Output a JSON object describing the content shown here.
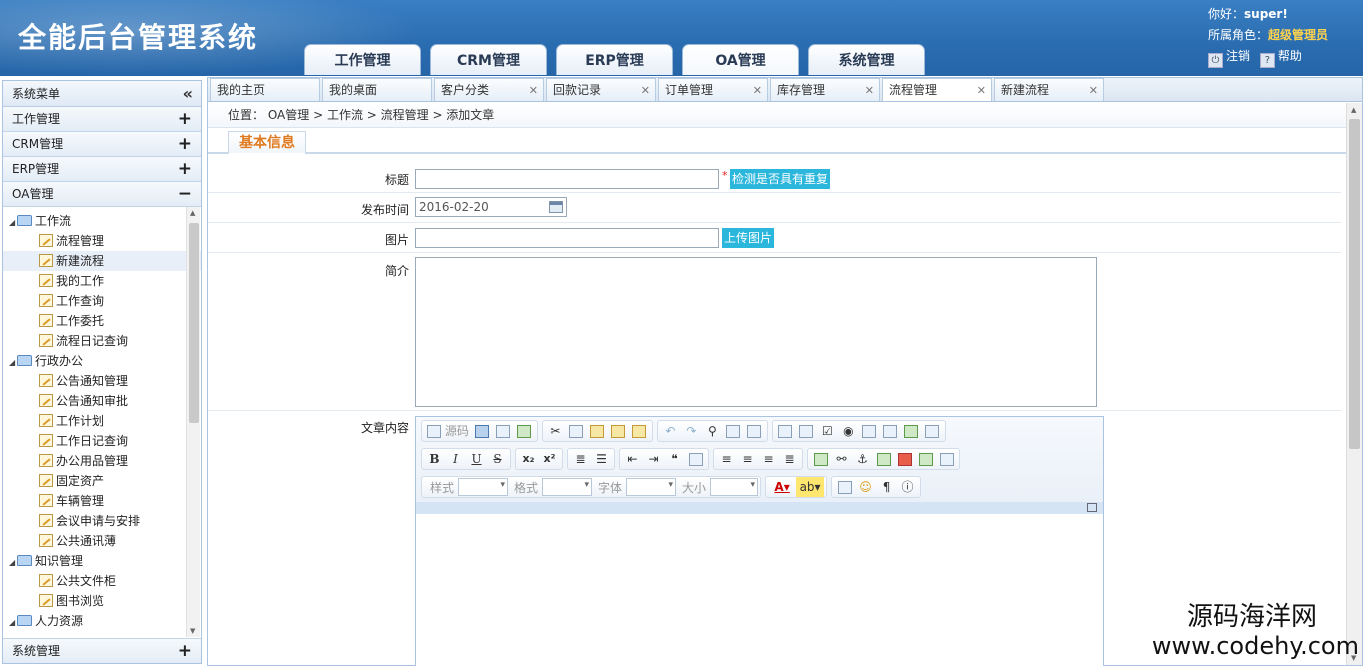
{
  "app": {
    "title": "全能后台管理系统",
    "main_tabs": [
      "工作管理",
      "CRM管理",
      "ERP管理",
      "OA管理",
      "系统管理"
    ]
  },
  "user": {
    "greeting": "你好：",
    "name": "super!",
    "role_label": "所属角色：",
    "role": "超级管理员",
    "logout": "注销",
    "help": "帮助"
  },
  "sidebar": {
    "title": "系统菜单",
    "collapse_icon": "«",
    "groups": [
      {
        "label": "工作管理",
        "toggle": "+"
      },
      {
        "label": "CRM管理",
        "toggle": "+"
      },
      {
        "label": "ERP管理",
        "toggle": "+"
      },
      {
        "label": "OA管理",
        "toggle": "−"
      }
    ],
    "tree": [
      {
        "label": "工作流",
        "type": "folder"
      },
      {
        "label": "流程管理",
        "type": "leaf"
      },
      {
        "label": "新建流程",
        "type": "leaf",
        "selected": true
      },
      {
        "label": "我的工作",
        "type": "leaf"
      },
      {
        "label": "工作查询",
        "type": "leaf"
      },
      {
        "label": "工作委托",
        "type": "leaf"
      },
      {
        "label": "流程日记查询",
        "type": "leaf"
      },
      {
        "label": "行政办公",
        "type": "folder"
      },
      {
        "label": "公告通知管理",
        "type": "leaf"
      },
      {
        "label": "公告通知审批",
        "type": "leaf"
      },
      {
        "label": "工作计划",
        "type": "leaf"
      },
      {
        "label": "工作日记查询",
        "type": "leaf"
      },
      {
        "label": "办公用品管理",
        "type": "leaf"
      },
      {
        "label": "固定资产",
        "type": "leaf"
      },
      {
        "label": "车辆管理",
        "type": "leaf"
      },
      {
        "label": "会议申请与安排",
        "type": "leaf"
      },
      {
        "label": "公共通讯薄",
        "type": "leaf"
      },
      {
        "label": "知识管理",
        "type": "folder"
      },
      {
        "label": "公共文件柜",
        "type": "leaf"
      },
      {
        "label": "图书浏览",
        "type": "leaf"
      },
      {
        "label": "人力资源",
        "type": "folder"
      }
    ],
    "bottom_group": {
      "label": "系统管理",
      "toggle": "+"
    }
  },
  "page_tabs": [
    {
      "label": "我的主页",
      "closable": false
    },
    {
      "label": "我的桌面",
      "closable": false
    },
    {
      "label": "客户分类",
      "closable": true
    },
    {
      "label": "回款记录",
      "closable": true
    },
    {
      "label": "订单管理",
      "closable": true
    },
    {
      "label": "库存管理",
      "closable": true
    },
    {
      "label": "流程管理",
      "closable": true,
      "active": true
    },
    {
      "label": "新建流程",
      "closable": true
    }
  ],
  "breadcrumb": "位置： OA管理 > 工作流 > 流程管理 > 添加文章",
  "section_tab": "基本信息",
  "form": {
    "title_label": "标题",
    "title_value": "",
    "required_mark": "*",
    "check_button": "检测是否具有重复",
    "date_label": "发布时间",
    "date_value": "2016-02-20",
    "image_label": "图片",
    "image_value": "",
    "upload_button": "上传图片",
    "intro_label": "简介",
    "intro_value": "",
    "content_label": "文章内容"
  },
  "editor": {
    "source_label": "源码",
    "style_label": "样式",
    "format_label": "格式",
    "font_label": "字体",
    "size_label": "大小",
    "bold": "B",
    "italic": "I",
    "underline": "U",
    "strike": "S",
    "subscript": "x₂",
    "superscript": "x²"
  },
  "watermark": {
    "cn": "源码海洋网",
    "en": "www.codehy.com"
  }
}
